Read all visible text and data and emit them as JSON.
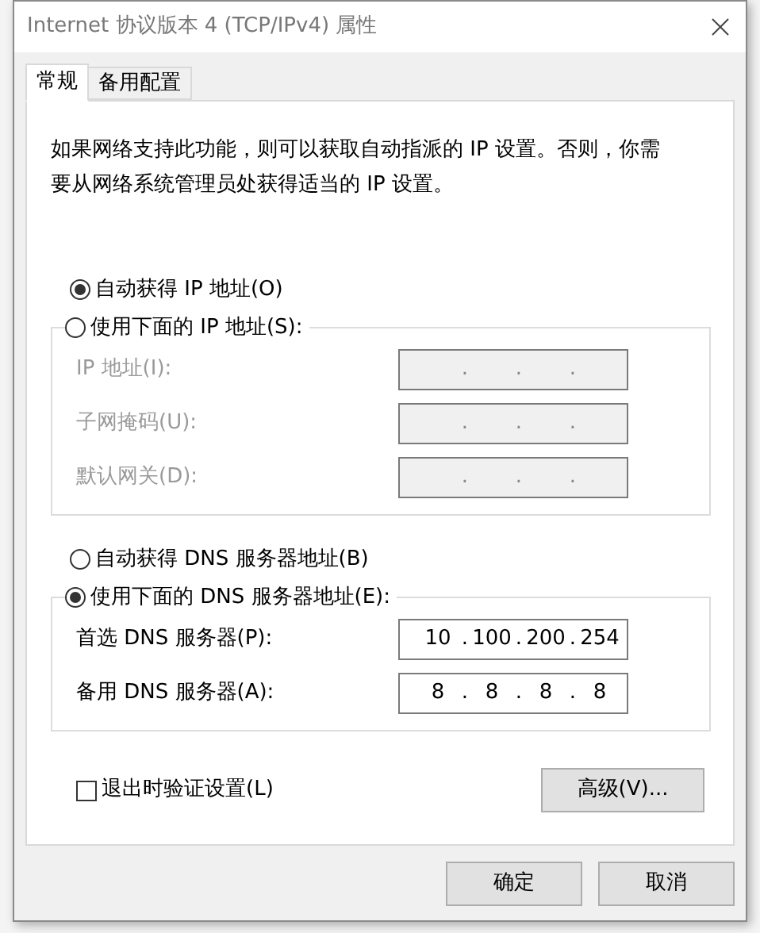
{
  "window": {
    "title": "Internet 协议版本 4 (TCP/IPv4) 属性"
  },
  "tabs": [
    {
      "label": "常规",
      "selected": true
    },
    {
      "label": "备用配置",
      "selected": false
    }
  ],
  "description": "如果网络支持此功能，则可以获取自动指派的 IP 设置。否则，你需要从网络系统管理员处获得适当的 IP 设置。",
  "octet_separator": ".",
  "ip_options": [
    {
      "label": "自动获得 IP 地址(O)",
      "selected": true
    },
    {
      "label": "使用下面的 IP 地址(S):",
      "selected": false
    }
  ],
  "ip_fields": [
    {
      "label": "IP 地址(I):",
      "disabled": true
    },
    {
      "label": "子网掩码(U):",
      "disabled": true
    },
    {
      "label": "默认网关(D):",
      "disabled": true
    }
  ],
  "dns_options": [
    {
      "label": "自动获得 DNS 服务器地址(B)",
      "selected": false
    },
    {
      "label": "使用下面的 DNS 服务器地址(E):",
      "selected": true
    }
  ],
  "dns_fields": [
    {
      "label": "首选 DNS 服务器(P):",
      "disabled": false,
      "octets": [
        "10",
        "100",
        "200",
        "254"
      ]
    },
    {
      "label": "备用 DNS 服务器(A):",
      "disabled": false,
      "octets": [
        "8",
        "8",
        "8",
        "8"
      ]
    }
  ],
  "validate_checkbox": {
    "label": "退出时验证设置(L)",
    "checked": false
  },
  "advanced_button": "高级(V)...",
  "buttons": [
    "确定",
    "取消"
  ]
}
